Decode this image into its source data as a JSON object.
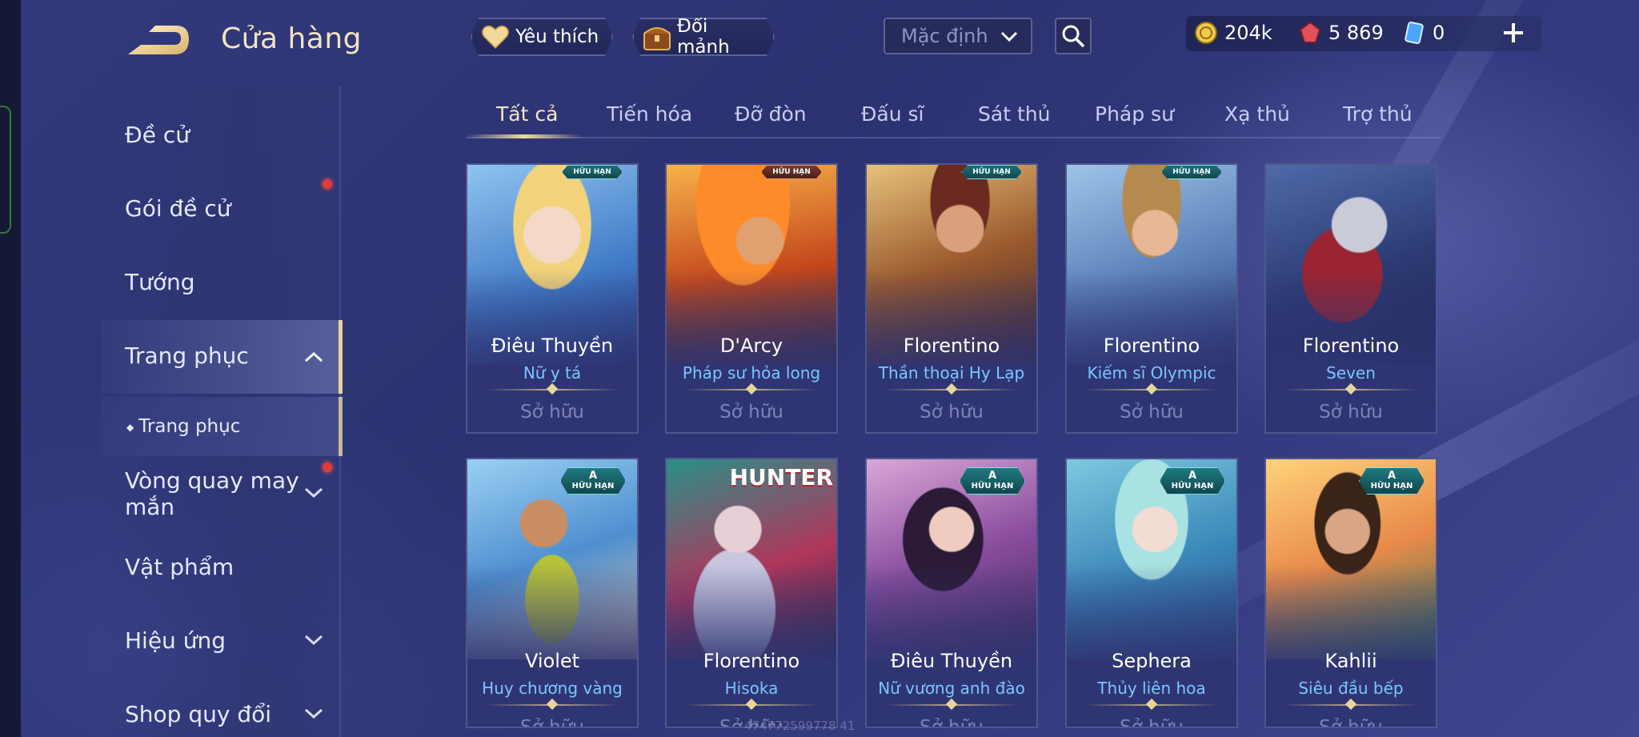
{
  "header": {
    "title": "Cửa hàng",
    "favorite_label": "Yêu thích",
    "shard_label": "Đổi mảnh",
    "sort_value": "Mặc định",
    "currency": {
      "gold": "204k",
      "ruby": "5 869",
      "card": "0"
    }
  },
  "sidebar": {
    "items": [
      {
        "label": "Đề cử"
      },
      {
        "label": "Gói đề cử"
      },
      {
        "label": "Tướng"
      },
      {
        "label": "Trang phục"
      },
      {
        "label": "Vòng quay may mắn"
      },
      {
        "label": "Vật phẩm"
      },
      {
        "label": "Hiệu ứng"
      },
      {
        "label": "Shop quy đổi"
      }
    ],
    "sub_item": "Trang phục"
  },
  "tabs": [
    "Tất cả",
    "Tiến hóa",
    "Đỡ đòn",
    "Đấu sĩ",
    "Sát thủ",
    "Pháp sư",
    "Xạ thủ",
    "Trợ thủ"
  ],
  "badges": {
    "limited": "HỮU HẠN",
    "tier": "A"
  },
  "cards": [
    {
      "hero": "Điêu Thuyền",
      "skin": "Nữ y tá",
      "status": "Sở hữu"
    },
    {
      "hero": "D'Arcy",
      "skin": "Pháp sư hỏa long",
      "status": "Sở hữu"
    },
    {
      "hero": "Florentino",
      "skin": "Thần thoại Hy Lạp",
      "status": "Sở hữu"
    },
    {
      "hero": "Florentino",
      "skin": "Kiếm sĩ Olympic",
      "status": "Sở hữu"
    },
    {
      "hero": "Florentino",
      "skin": "Seven",
      "status": "Sở hữu"
    },
    {
      "hero": "Violet",
      "skin": "Huy chương vàng",
      "status": "Sở hữu"
    },
    {
      "hero": "Florentino",
      "skin": "Hisoka",
      "status": "Sở hữu",
      "art_text": "HUNTER"
    },
    {
      "hero": "Điêu Thuyền",
      "skin": "Nữ vương anh đào",
      "status": "Sở hữu"
    },
    {
      "hero": "Sephera",
      "skin": "Thủy liên hoa",
      "status": "Sở hữu"
    },
    {
      "hero": "Kahlii",
      "skin": "Siêu đầu bếp",
      "status": "Sở hữu"
    }
  ],
  "watermark": "474772599778 41"
}
